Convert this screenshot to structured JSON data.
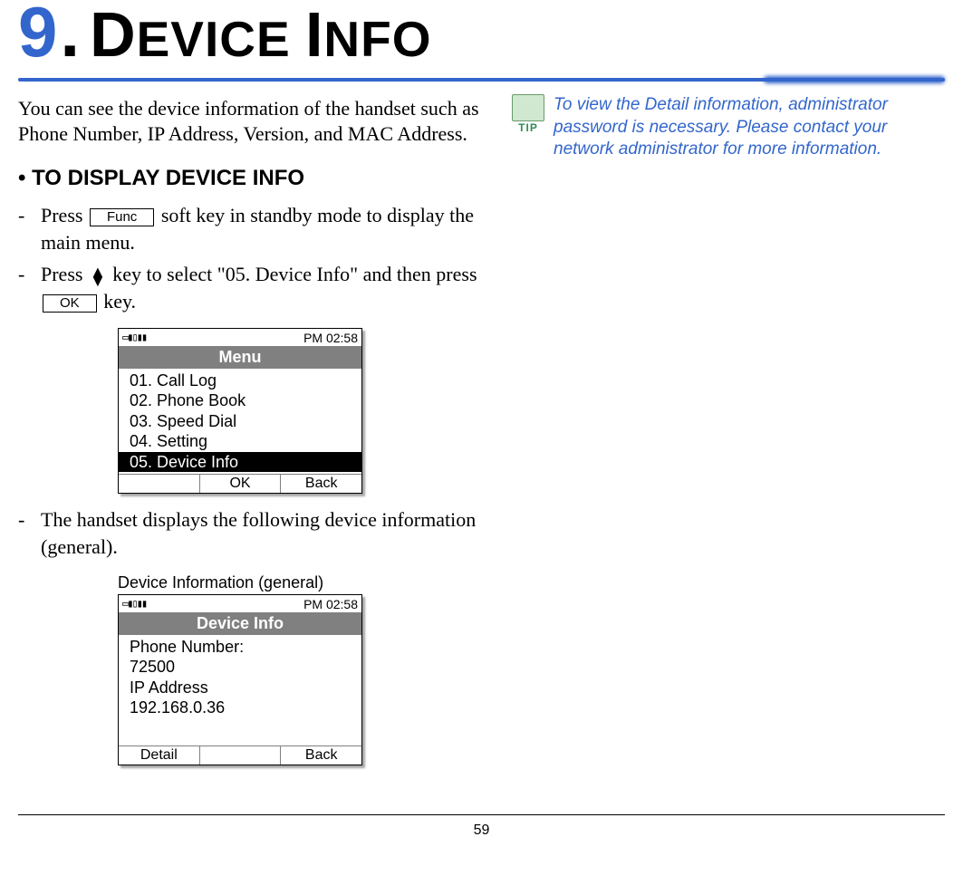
{
  "chapter": {
    "number": "9",
    "dot": ".",
    "title_smallcaps": {
      "cap1": "D",
      "r1": "EVICE",
      "space": " ",
      "cap2": "I",
      "r2": "NFO"
    }
  },
  "intro": "You can see the device information of the handset such as Phone Number, IP Address, Version, and MAC Address.",
  "section_heading_bullet": "•",
  "section_heading": "TO DISPLAY DEVICE INFO",
  "step1": {
    "prefix": "Press ",
    "key": "Func",
    "suffix": " soft key in standby mode to display the main menu."
  },
  "step2": {
    "prefix": "Press ",
    "middle": " key to select \"05. Device Info\" and then press ",
    "key": "OK",
    "suffix": " key."
  },
  "screen1": {
    "time": "PM 02:58",
    "icons": "▭▮▯▮▮",
    "title": "Menu",
    "items": [
      "01. Call Log",
      "02. Phone Book",
      "03. Speed Dial",
      "04. Setting"
    ],
    "selected": "05. Device Info",
    "soft": {
      "left": "",
      "mid": "OK",
      "right": "Back"
    }
  },
  "step3": "The handset displays the following device information (general).",
  "screen2_caption": "Device Information (general)",
  "screen2": {
    "time": "PM 02:58",
    "icons": "▭▮▯▮▮",
    "title": "Device Info",
    "lines": [
      "Phone Number:",
      "72500",
      "IP Address",
      "192.168.0.36"
    ],
    "soft": {
      "left": "Detail",
      "mid": "",
      "right": "Back"
    }
  },
  "tip": {
    "label": "TIP",
    "text": "To view the Detail information, administrator password is necessary. Please contact your network administrator for more information."
  },
  "page_number": "59"
}
